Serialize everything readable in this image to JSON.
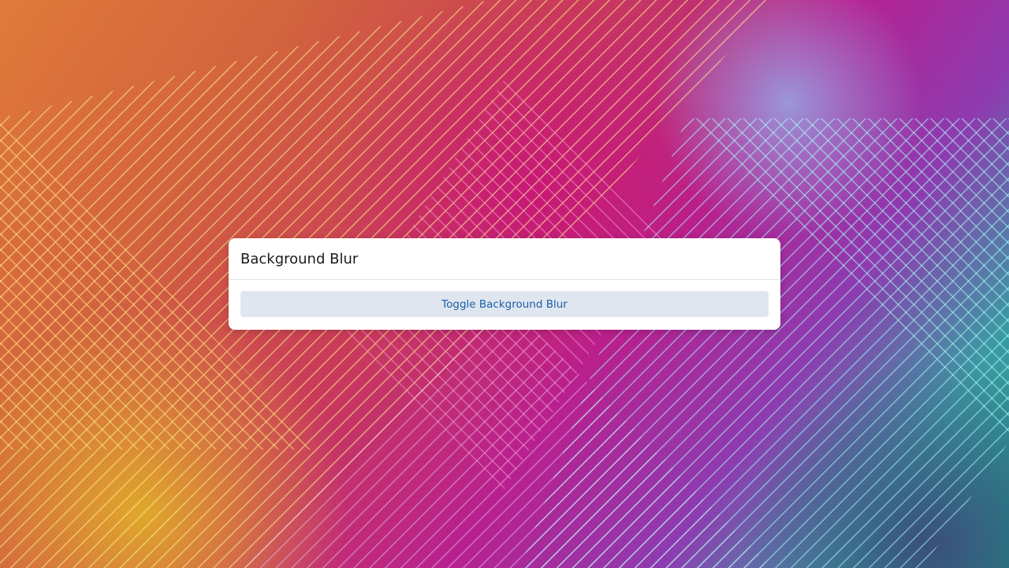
{
  "dialog": {
    "title": "Background Blur",
    "toggle_button_label": "Toggle Background Blur"
  },
  "colors": {
    "button_background": "#e0e6f0",
    "button_text": "#1a5fa6",
    "dialog_background": "#ffffff"
  }
}
